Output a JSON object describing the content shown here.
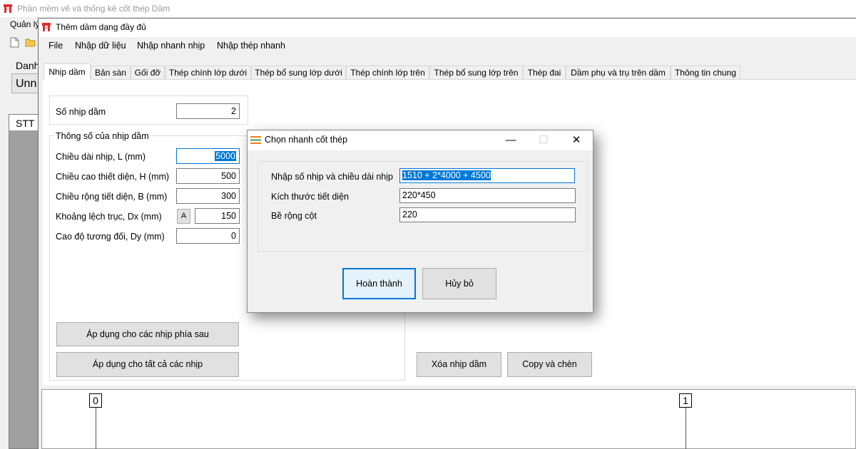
{
  "main_app": {
    "title": "Phần mềm vẽ và thống kê cốt thép Dầm",
    "menu_label": "Quản lý",
    "danh_label": "Danh",
    "combo_text": "Unn",
    "grid_header": "STT"
  },
  "beam_dialog": {
    "title": "Thêm dầm dạng đầy đủ",
    "menu": [
      "File",
      "Nhập dữ liệu",
      "Nhập nhanh nhịp",
      "Nhập thép nhanh"
    ],
    "tabs": [
      "Nhịp dầm",
      "Bản sàn",
      "Gối đỡ",
      "Thép chính lớp dưới",
      "Thép bổ sung lớp dưới",
      "Thép chính lớp trên",
      "Thép bổ sung lớp trên",
      "Thép đai",
      "Dầm phụ và trụ trên dầm",
      "Thông tin chung"
    ],
    "active_tab": "Nhịp dầm",
    "span_count_label": "Số nhịp dầm",
    "span_count_value": "2",
    "params_group_title": "Thông số của nhịp dầm",
    "fields": {
      "length_label": "Chiều dài nhịp, L (mm)",
      "length_value": "5000",
      "height_label": "Chiều cao thiết diện, H (mm)",
      "height_value": "500",
      "width_label": "Chiều rộng tiết diện, B (mm)",
      "width_value": "300",
      "dx_label": "Khoảng lệch trục, Dx (mm)",
      "dx_button": "A",
      "dx_value": "150",
      "dy_label": "Cao độ tương đối, Dy (mm)",
      "dy_value": "0"
    },
    "buttons": {
      "apply_following": "Áp dụng cho các nhịp phía sau",
      "apply_all": "Áp dụng cho tất cả các nhịp",
      "delete_span": "Xóa nhịp dầm",
      "copy_insert": "Copy và chèn"
    },
    "preview": {
      "axis_labels": [
        "0",
        "1"
      ]
    }
  },
  "quick_dialog": {
    "title": "Chọn nhanh cốt thép",
    "controls": {
      "minimize": "—",
      "maximize": "☐",
      "close": "✕"
    },
    "spans_label": "Nhập số nhịp và chiều dài nhịp",
    "spans_value": "1510 + 2*4000 + 4500",
    "section_label": "Kích thước tiết diện",
    "section_value": "220*450",
    "column_label": "Bề rộng cột",
    "column_value": "220",
    "ok_button": "Hoàn thành",
    "cancel_button": "Hủy bỏ"
  },
  "colors": {
    "selection": "#0078d7",
    "window_bg": "#f0f0f0",
    "button_bg": "#e1e1e1"
  },
  "icons": [
    "app-icon",
    "new-file-icon",
    "open-folder-icon",
    "quick-rebar-icon",
    "minimize-icon",
    "maximize-icon",
    "close-icon"
  ]
}
